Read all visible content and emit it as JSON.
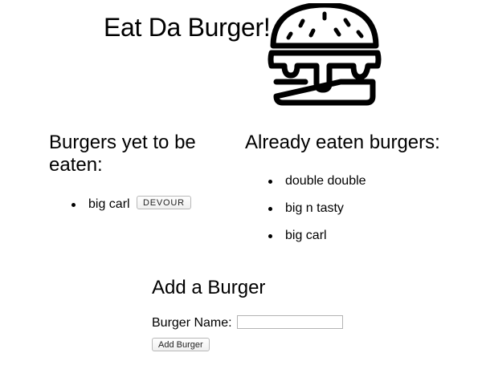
{
  "header": {
    "title": "Eat Da Burger!",
    "logo_icon": "burger-icon"
  },
  "uneaten": {
    "heading": "Burgers yet to be eaten:",
    "items": [
      {
        "name": "big carl",
        "button_label": "DEVOUR"
      }
    ]
  },
  "eaten": {
    "heading": "Already eaten burgers:",
    "items": [
      {
        "name": "double double"
      },
      {
        "name": "big n tasty"
      },
      {
        "name": "big carl"
      }
    ]
  },
  "add_form": {
    "heading": "Add a Burger",
    "field_label": "Burger Name:",
    "field_value": "",
    "submit_label": "Add Burger"
  },
  "colors": {
    "text": "#000000",
    "background": "#ffffff",
    "button_border": "#b8b8b8"
  }
}
